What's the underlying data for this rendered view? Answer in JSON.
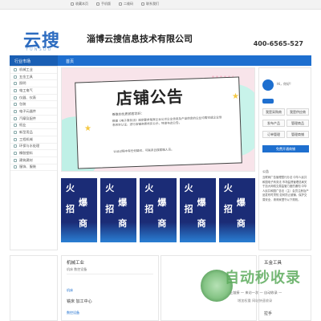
{
  "topbar": {
    "links": [
      "收藏本页",
      "手机版",
      "二维码",
      "联系我们"
    ]
  },
  "brand": {
    "logo_text": "云搜",
    "logo_sub": "YUNSOU",
    "company_name": "淄博云搜信息技术有限公司",
    "phone": "400-6565-527"
  },
  "nav": {
    "category_label": "行业市场",
    "home_label": "首页"
  },
  "sidebar": {
    "items": [
      "机械工业",
      "五金工具",
      "照明",
      "电工电气",
      "仪器、仪表",
      "包装",
      "电子元器件",
      "汽摩及配件",
      "纸业",
      "新型用品",
      "工程机械",
      "环保与水处理",
      "橡胶塑料",
      "建筑建材",
      "服饰、服装"
    ]
  },
  "banner": {
    "title": "店铺公告",
    "line1": "尊敬的优质顾客您好：",
    "line2": "根据《电子商务法》规定要求每家企业公示企业信息及产品信息的企业均需完成企业信息核实认证，进行店铺资质核实公示，特发布此公告。",
    "line3": "认证过程中有任何疑问，可联系云搜客服人员。"
  },
  "posters": [
    {
      "a": "火",
      "b": "招",
      "c": "爆",
      "d": "商"
    },
    {
      "a": "火",
      "b": "招",
      "c": "爆",
      "d": "商"
    },
    {
      "a": "火",
      "b": "招",
      "c": "爆",
      "d": "商"
    },
    {
      "a": "火",
      "b": "招",
      "c": "爆",
      "d": "商"
    },
    {
      "a": "火",
      "b": "招",
      "c": "爆",
      "d": "商"
    }
  ],
  "panel": {
    "greeting": "Hi，你好!",
    "btn_login": "我是采购商",
    "btn_seller": "我是供应商",
    "btn_supply": "发布产品",
    "btn_manage": "管理商品",
    "btn_orders": "订单管理",
    "btn_shop": "管理商铺",
    "btn_open": "免费开通商铺",
    "notice_label": "公告",
    "notice_text": "互联网广告管理暂行办法 中华人民共和国电子商务法 市场监督管理总局关于加大网络交易监管力度的通知 中华人民共和国广告法（主）会员注册及产品发布时须知 如何防止被骗，保护交易安全，请商家遵守以下规则。"
  },
  "sections": {
    "left": {
      "title": "机械工业",
      "sub": "机床  数控设备"
    },
    "mid": {
      "title": "机械工业",
      "sub": "机床  数控设备"
    },
    "mid_item1": "机床",
    "mid_item2": "铣床 加工中心",
    "mid_item3": "数控设备",
    "right_title": "五金工具",
    "right_item": "拉手"
  },
  "watermark": {
    "title": "自动秒收录",
    "sub1": "上链接 — 来访一次 — 自动收录 —",
    "sub2": "增加权重 网站快速收录"
  }
}
